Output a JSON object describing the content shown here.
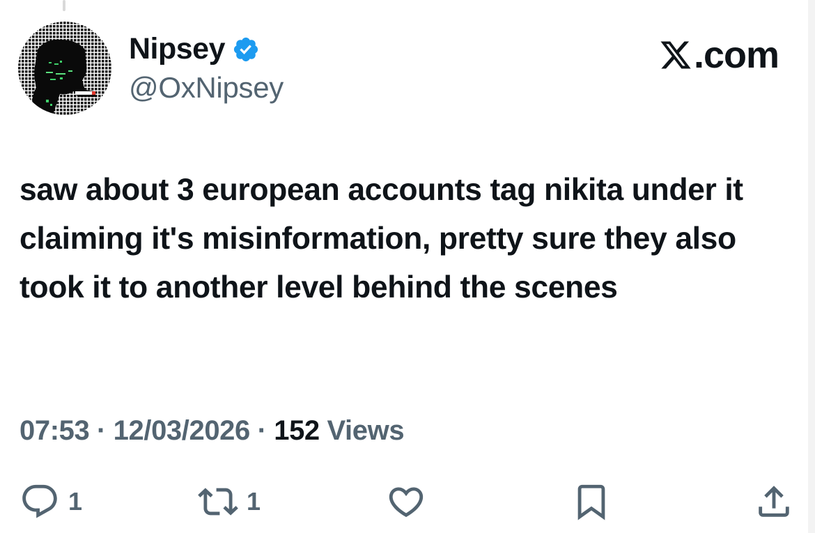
{
  "author": {
    "display_name": "Nipsey",
    "handle": "@OxNipsey",
    "verified": true
  },
  "brand": {
    "label": ".com",
    "logo_icon": "x-logo-icon"
  },
  "post": {
    "text": "saw about 3 european accounts tag nikita under it claiming it's misinformation, pretty sure they also took it to another level behind the scenes"
  },
  "meta": {
    "time": "07:53",
    "separator": "·",
    "date": "12/03/2026",
    "views_count": "152",
    "views_label": "Views"
  },
  "actions": {
    "replies": {
      "icon": "reply-icon",
      "count": "1"
    },
    "reposts": {
      "icon": "repost-icon",
      "count": "1"
    },
    "like": {
      "icon": "heart-icon"
    },
    "bookmark": {
      "icon": "bookmark-icon"
    },
    "share": {
      "icon": "share-icon"
    }
  },
  "colors": {
    "text_primary": "#0f1419",
    "text_secondary": "#536471",
    "verified_blue": "#1d9bf0",
    "background": "#ffffff"
  }
}
